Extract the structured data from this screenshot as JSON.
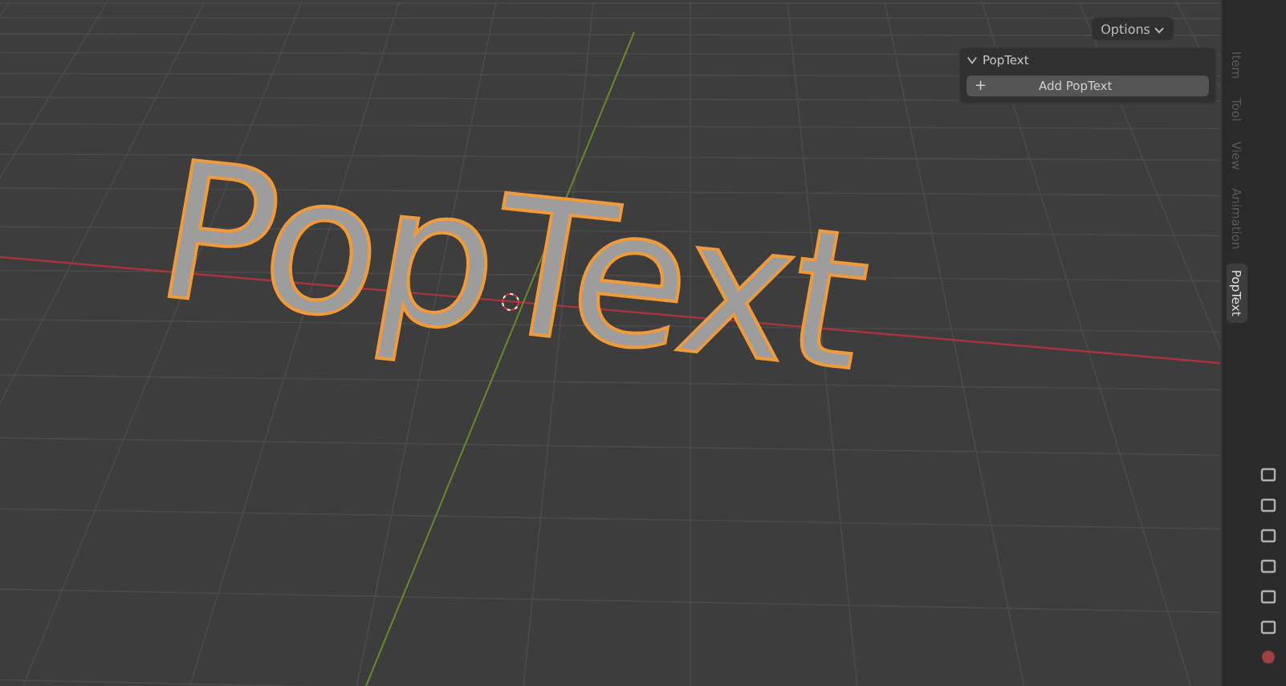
{
  "header": {
    "options": "Options"
  },
  "scene": {
    "text_object": "PopText",
    "selected": true
  },
  "panel": {
    "title": "PopText",
    "expanded": true,
    "button_icon": "+",
    "button_label": "Add PopText"
  },
  "tabs": [
    {
      "label": "Item",
      "selected": false
    },
    {
      "label": "Tool",
      "selected": false
    },
    {
      "label": "View",
      "selected": false
    },
    {
      "label": "Animation",
      "selected": false
    },
    {
      "label": "PopText",
      "selected": true
    }
  ]
}
